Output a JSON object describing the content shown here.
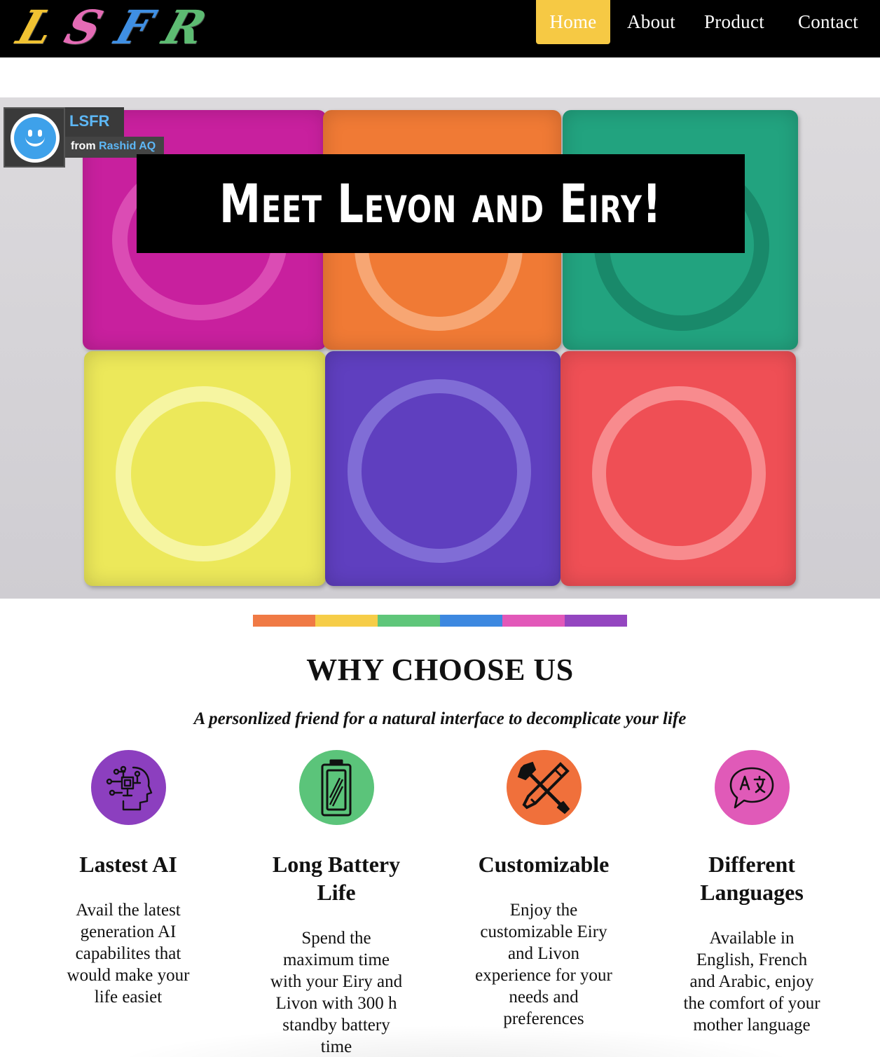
{
  "logo": {
    "text": "LSFR",
    "letters": [
      "L",
      "S",
      "F",
      "R"
    ],
    "colors": [
      "#f1c232",
      "#e46bb5",
      "#3f8fe3",
      "#5dbb72"
    ]
  },
  "nav": {
    "items": [
      {
        "label": "Home",
        "active": true
      },
      {
        "label": "About",
        "active": false
      },
      {
        "label": "Product",
        "active": false
      },
      {
        "label": "Contact",
        "active": false
      }
    ],
    "active_color": "#f6c944"
  },
  "hero": {
    "channel_name": "LSFR",
    "channel_from": "from",
    "channel_author": "Rashid AQ",
    "title": "Meet Levon and Eiry!",
    "block_colors": [
      "#c8209e",
      "#f07a35",
      "#22a37f",
      "#ece85a",
      "#5f3fbf",
      "#ef4f55"
    ]
  },
  "rainbow_colors": [
    "#f07a45",
    "#f6cd48",
    "#5fc67a",
    "#3d88e0",
    "#e258b9",
    "#9446c0"
  ],
  "why": {
    "title": "WHY CHOOSE US",
    "subtitle": "A personlized friend for a natural interface to decomplicate your life"
  },
  "features": [
    {
      "icon": "ai-brain-icon",
      "color": "#8c3fbf",
      "title": "Lastest AI",
      "desc": "Avail the latest generation AI capabilites that would make your life easiet"
    },
    {
      "icon": "battery-icon",
      "color": "#5bc47a",
      "title": "Long Battery Life",
      "desc": "Spend the maximum time with your Eiry and Livon with 300 h standby battery time"
    },
    {
      "icon": "tools-icon",
      "color": "#f0703b",
      "title": "Customizable",
      "desc": "Enjoy the customizable Eiry and Livon experience for your needs and preferences"
    },
    {
      "icon": "translate-icon",
      "color": "#e05ab8",
      "title": "Different Languages",
      "desc": "Available in English, French and Arabic, enjoy the comfort of your mother language"
    }
  ]
}
